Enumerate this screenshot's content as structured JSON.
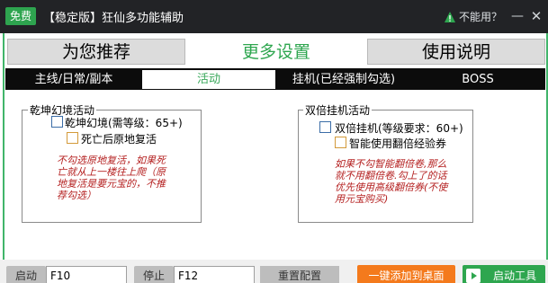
{
  "titlebar": {
    "badge": "免费",
    "title": "【稳定版】狂仙多功能辅助",
    "help_link": "不能用？",
    "minimize": "—",
    "close": "✕"
  },
  "main_tabs": [
    {
      "label": "为您推荐",
      "active": false
    },
    {
      "label": "更多设置",
      "active": true
    },
    {
      "label": "使用说明",
      "active": false
    }
  ],
  "sub_tabs": [
    {
      "label": "主线/日常/副本",
      "active": false
    },
    {
      "label": "活动",
      "active": true
    },
    {
      "label": "挂机(已经强制勾选)",
      "active": false
    },
    {
      "label": "BOSS",
      "active": false
    }
  ],
  "groups": {
    "qiankun": {
      "title": "乾坤幻境活动",
      "items": [
        {
          "label": "乾坤幻境(需等级：65+)",
          "checked": false
        },
        {
          "label": "死亡后原地复活",
          "checked": false
        }
      ],
      "note": "不勾选原地复活，如果死亡就从上一楼往上爬（原地复活是要元宝的，不推荐勾选）"
    },
    "double": {
      "title": "双倍挂机活动",
      "items": [
        {
          "label": "双倍挂机(等级要求：60+)",
          "checked": false
        },
        {
          "label": "智能使用翻倍经验券",
          "checked": false
        }
      ],
      "note": "如果不勾智能翻倍卷,那么就不用翻倍卷.勾上了的话优先使用高级翻倍券(不使用元宝购买)"
    }
  },
  "bottom": {
    "start_label": "启动",
    "start_key": "F10",
    "stop_label": "停止",
    "stop_key": "F12",
    "reset_button": "重置配置",
    "add_desktop_button": "一键添加到桌面",
    "launch_button": "启动工具"
  },
  "colors": {
    "titlebar_bg": "#222326",
    "accent_green": "#2ea64f",
    "orange": "#f47a1c",
    "note_red": "#b41f1f"
  }
}
